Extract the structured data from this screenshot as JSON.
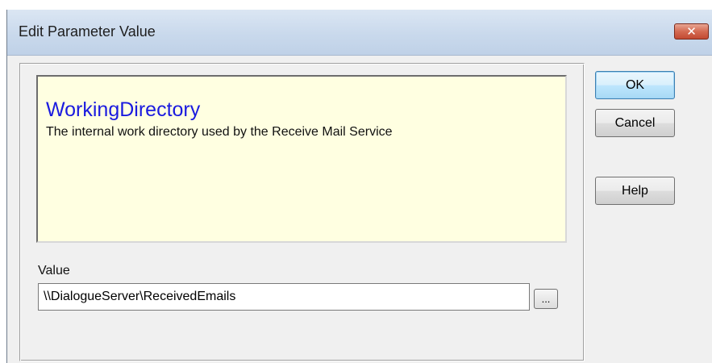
{
  "window": {
    "title": "Edit Parameter Value",
    "close_glyph": "✕"
  },
  "info": {
    "param_name": "WorkingDirectory",
    "description": "The internal work directory used by the Receive Mail Service"
  },
  "value_field": {
    "label": "Value",
    "value": "\\\\DialogueServer\\ReceivedEmails",
    "browse_label": "..."
  },
  "buttons": {
    "ok": "OK",
    "cancel": "Cancel",
    "help": "Help"
  },
  "colors": {
    "param_name": "#1a1adf",
    "info_background": "#ffffe1",
    "close_button": "#c24a32"
  },
  "icons": {
    "close": "close-icon"
  }
}
